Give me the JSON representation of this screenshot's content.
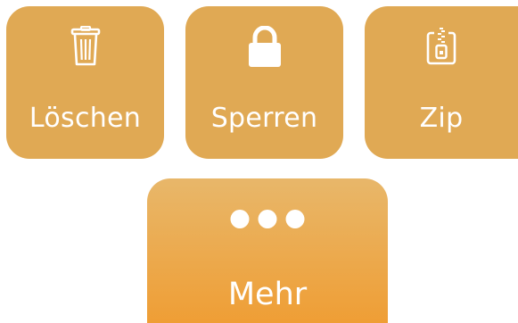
{
  "actions": {
    "delete": {
      "label": "Löschen",
      "icon": "trash-icon"
    },
    "lock": {
      "label": "Sperren",
      "icon": "lock-icon"
    },
    "zip": {
      "label": "Zip",
      "icon": "zip-archive-icon"
    },
    "more": {
      "label": "Mehr",
      "icon": "more-dots-icon"
    }
  },
  "colors": {
    "tile": "#e0a954",
    "more_top": "#e8b76a",
    "more_bottom": "#ef9e35",
    "text": "#ffffff"
  }
}
